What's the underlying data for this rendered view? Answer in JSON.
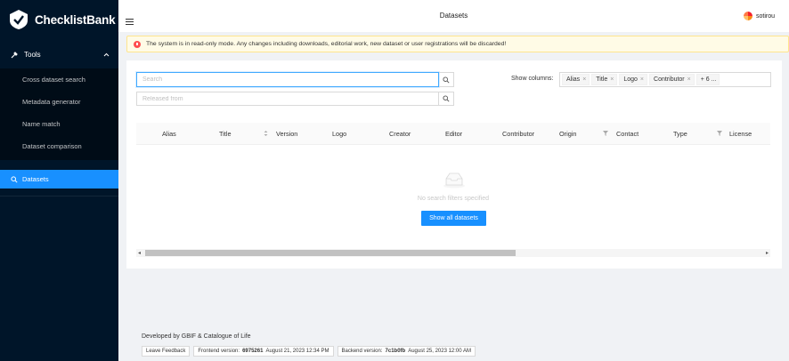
{
  "sidebar": {
    "brand": "ChecklistBank",
    "tools_label": "Tools",
    "tools_items": [
      "Cross dataset search",
      "Metadata generator",
      "Name match",
      "Dataset comparison"
    ],
    "datasets_label": "Datasets"
  },
  "header": {
    "title": "Datasets",
    "user": "sotirou"
  },
  "alert": {
    "message": "The system is in read-only mode. Any changes including downloads, editorial work, new dataset or user registrations will be discarded!"
  },
  "search": {
    "placeholder": "Search",
    "released_placeholder": "Released from"
  },
  "columns": {
    "label": "Show columns:",
    "tags": [
      "Alias",
      "Title",
      "Logo",
      "Contributor"
    ],
    "more": "+ 6 ..."
  },
  "table": {
    "headers": [
      "Alias",
      "Title",
      "Version",
      "Logo",
      "Creator",
      "Editor",
      "Contributor",
      "Origin",
      "Contact",
      "Type",
      "License"
    ],
    "empty_text": "No search filters specified",
    "show_all_label": "Show all datasets"
  },
  "footer": {
    "developed_by": "Developed by GBIF & Catalogue of Life",
    "feedback": "Leave Feedback",
    "frontend_label": "Frontend version:",
    "frontend_hash": "6975261",
    "frontend_date": "August 21, 2023 12:34 PM",
    "backend_label": "Backend version:",
    "backend_hash": "7c1b0fb",
    "backend_date": "August 25, 2023 12:00 AM"
  },
  "colors": {
    "sidebar_bg": "#001529",
    "accent": "#1890ff",
    "alert_bg": "#fffbe6",
    "alert_dot": "#ff4d4f"
  }
}
